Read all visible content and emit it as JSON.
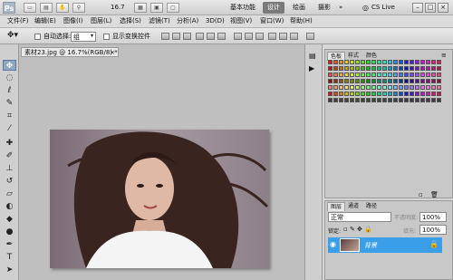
{
  "app": {
    "logo": "Ps"
  },
  "titlebar": {
    "zoom": "16.7",
    "workspace_buttons": [
      "基本功能",
      "设计",
      "绘画",
      "摄影"
    ],
    "active_workspace": "设计",
    "cs_live": "CS Live"
  },
  "menu": [
    "文件(F)",
    "编辑(E)",
    "图像(I)",
    "图层(L)",
    "选择(S)",
    "滤镜(T)",
    "分析(A)",
    "3D(D)",
    "视图(V)",
    "窗口(W)",
    "帮助(H)"
  ],
  "options": {
    "auto_select_label": "自动选择:",
    "auto_select_value": "组",
    "show_transform_label": "显示变换控件"
  },
  "document": {
    "tab_label": "素材23.jpg @ 16.7%(RGB/8) *"
  },
  "color_panel": {
    "tabs": [
      "色板",
      "样式",
      "颜色"
    ]
  },
  "layers_panel": {
    "tabs": [
      "图层",
      "通道",
      "路径"
    ],
    "blend_mode": "正常",
    "opacity_label": "不透明度:",
    "opacity_value": "100%",
    "lock_label": "锁定:",
    "fill_label": "填充:",
    "fill_value": "100%",
    "layer_name": "背景"
  }
}
